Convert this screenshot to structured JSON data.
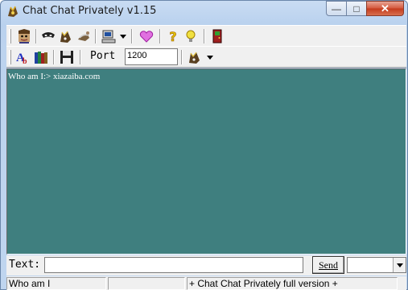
{
  "window": {
    "title": "Chat Chat Privately v1.15",
    "min_glyph": "—",
    "max_glyph": "□",
    "close_glyph": "✕"
  },
  "toolbar": {
    "port_label": "Port",
    "port_value": "1200"
  },
  "chat": {
    "lines": [
      "Who am I:> xiazaiba.com"
    ]
  },
  "input": {
    "label": "Text:",
    "value": "",
    "send_label": "Send",
    "combo_value": ""
  },
  "status": {
    "panel1": "Who am I",
    "panel2": "",
    "panel3": "+ Chat Chat Privately full version +"
  },
  "colors": {
    "chat_bg": "#3f7f7f",
    "chat_text": "#ffffff"
  },
  "icons": [
    "app-icon",
    "user-face-icon",
    "mask-icon",
    "cat-icon",
    "cat-walk-icon",
    "computer-icon",
    "heart-icon",
    "help-icon",
    "lightbulb-icon",
    "exit-door-icon",
    "font-icon",
    "books-icon",
    "floppy-icon",
    "cat-menu-icon"
  ]
}
